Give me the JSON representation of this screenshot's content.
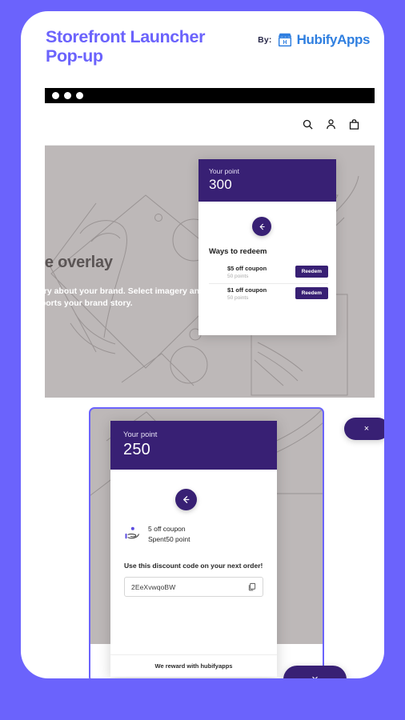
{
  "theme": {
    "page_background": "#6b63fc",
    "card_background": "#ffffff",
    "brand_blue": "#2f7fe0",
    "accent_purple": "#6b63fc",
    "popup_purple": "#382074",
    "hero_grey": "#bdb8b8"
  },
  "header": {
    "title": "Storefront Launcher Pop-up",
    "by_label": "By:",
    "brand_name": "HubifyApps",
    "brand_icon": "storefront-icon"
  },
  "browser": {
    "window_dots": [
      "dot-1",
      "dot-2",
      "dot-3"
    ],
    "nav_icons": [
      {
        "name": "search-icon"
      },
      {
        "name": "account-icon"
      },
      {
        "name": "shopping-bag-icon"
      }
    ]
  },
  "hero": {
    "heading": "Image overlay",
    "subtext": "Tell a story about your brand. Select imagery and text that supports your brand story.",
    "art": "line-art-shoes-illustration"
  },
  "popup_ways_to_redeem": {
    "header_label": "Your point",
    "points": "300",
    "back_icon": "arrow-left-icon",
    "section_title": "Ways to redeem",
    "items": [
      {
        "name": "$5 off coupon",
        "points": "50 points",
        "button": "Reedem"
      },
      {
        "name": "$1 off coupon",
        "points": "50 points",
        "button": "Reedem"
      }
    ],
    "close_label": "×"
  },
  "popup_discount_code": {
    "header_label": "Your point",
    "points": "250",
    "back_icon": "arrow-left-icon",
    "coupon_icon": "hand-coin-icon",
    "coupon_name": "5 off coupon",
    "coupon_spent": "Spent50 point",
    "discount_label": "Use this discount code on your next order!",
    "code_value": "2EeXvwqoBW",
    "copy_icon": "copy-icon",
    "footer_text": "We reward with hubifyapps",
    "close_label": "×"
  }
}
